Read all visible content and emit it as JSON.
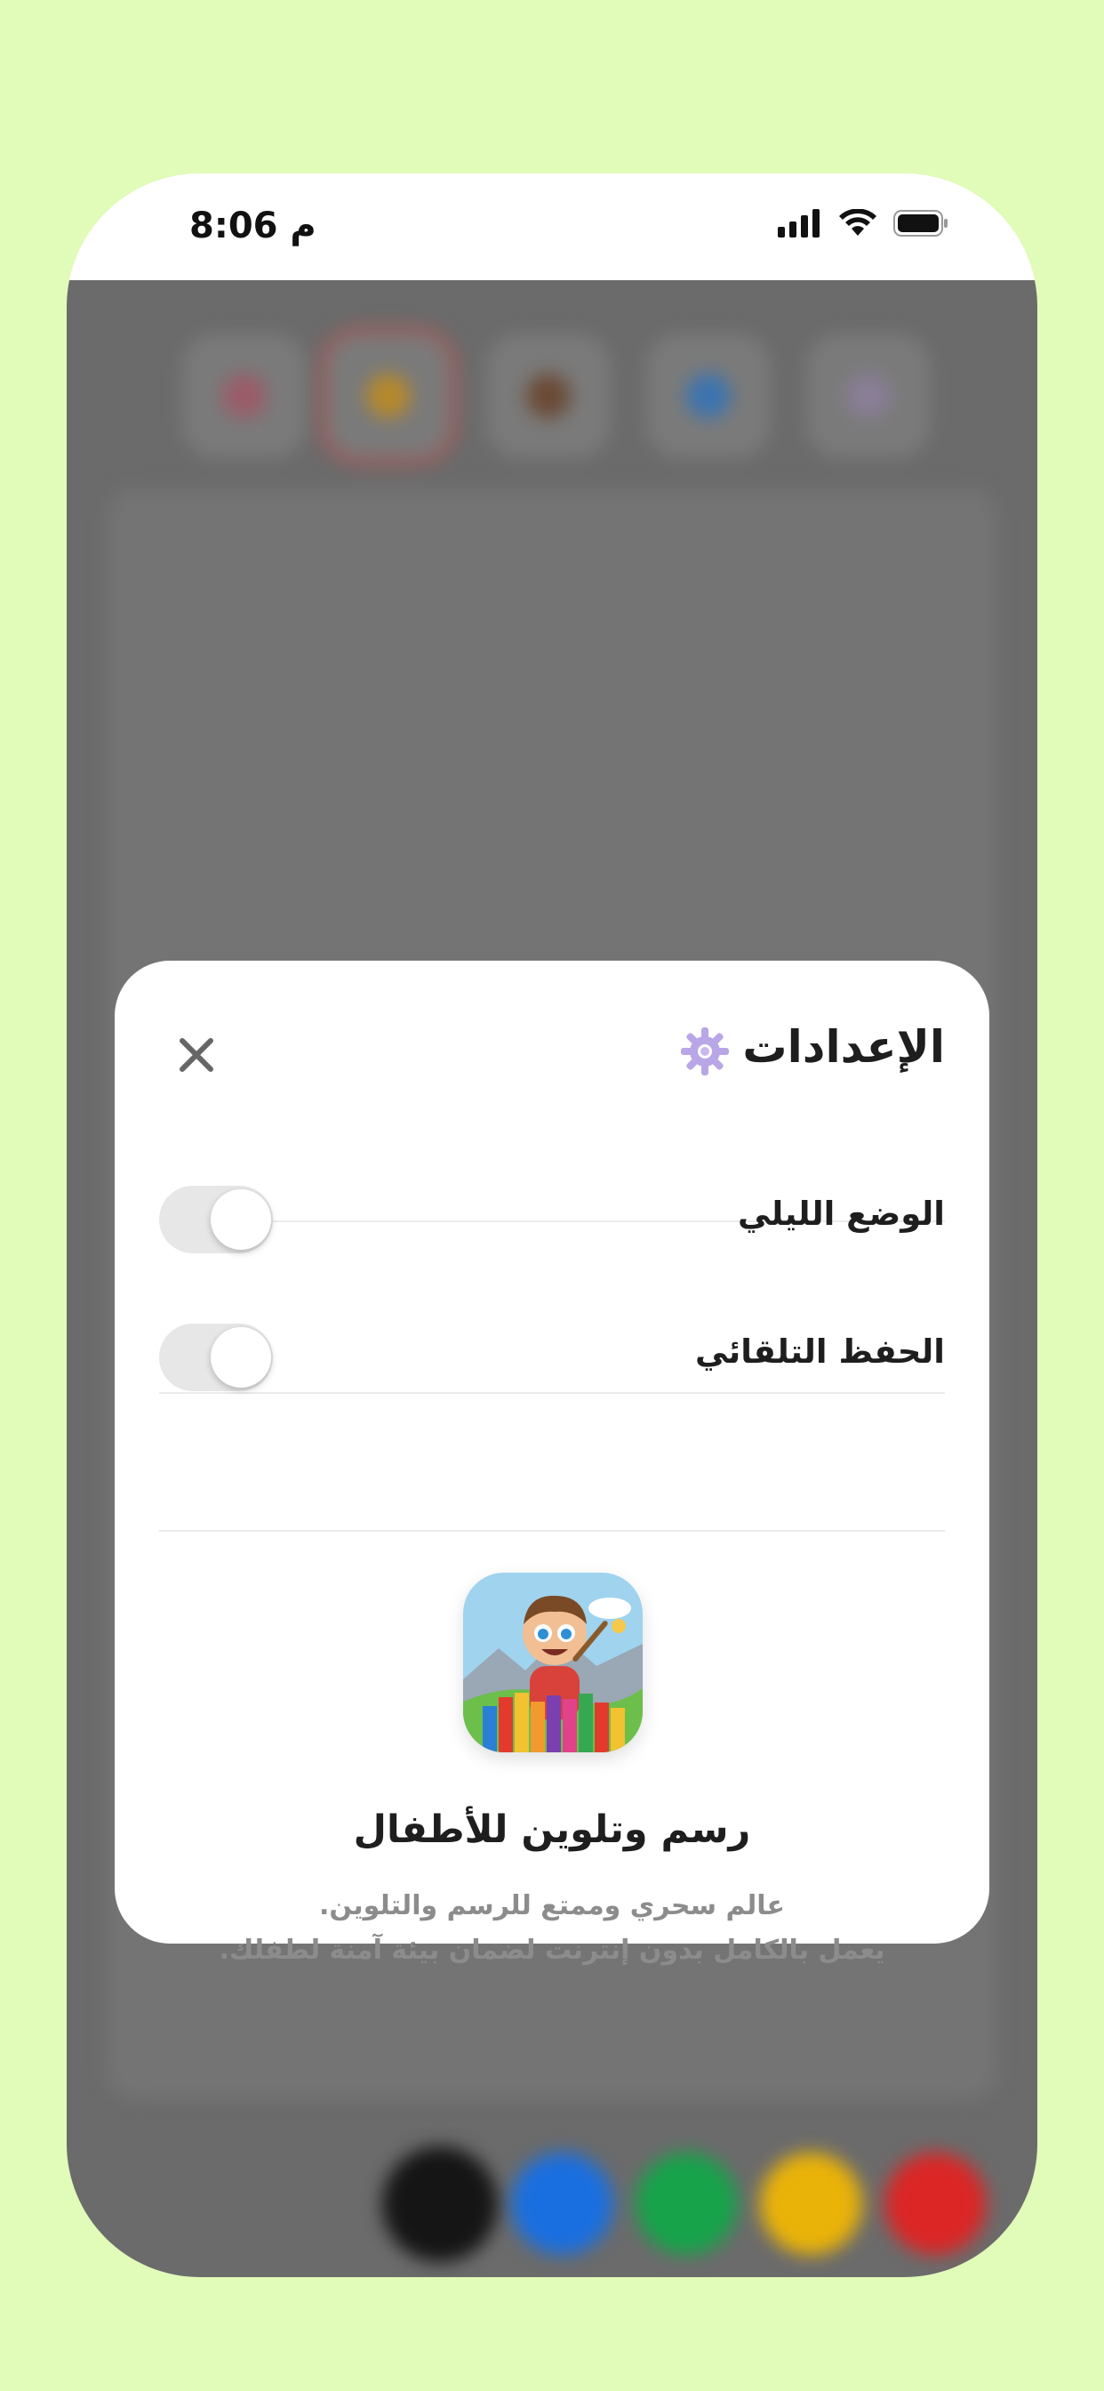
{
  "status_bar": {
    "time": "8:06 م",
    "icons": [
      "signal-icon",
      "wifi-icon",
      "battery-icon"
    ]
  },
  "background_app": {
    "toolbar_tools": [
      "brush-tool",
      "crayon-tool",
      "bucket-tool",
      "spray-tool",
      "eraser-tool"
    ],
    "palette_colors": [
      "#151515",
      "#1a6fe0",
      "#16a34a",
      "#eab308",
      "#dc2626"
    ]
  },
  "settings_modal": {
    "title": "الإعدادات",
    "title_icon": "gear-icon",
    "close_icon": "close-icon",
    "options": [
      {
        "label": "الوضع الليلي",
        "enabled": false
      },
      {
        "label": "الحفظ التلقائي",
        "enabled": false
      }
    ],
    "app_info": {
      "icon": "app-logo",
      "name": "رسم وتلوين للأطفال",
      "description_line1": "عالم سحري وممتع للرسم والتلوين.",
      "description_line2": "يعمل بالكامل بدون إنترنت لضمان بيئة آمنة لطفلك."
    }
  },
  "colors": {
    "page_background": "#e1fbb8",
    "overlay": "#6b6b6b",
    "modal_background": "#ffffff",
    "toggle_off": "#e7e7e7",
    "gear_accent": "#b9a6e6"
  }
}
